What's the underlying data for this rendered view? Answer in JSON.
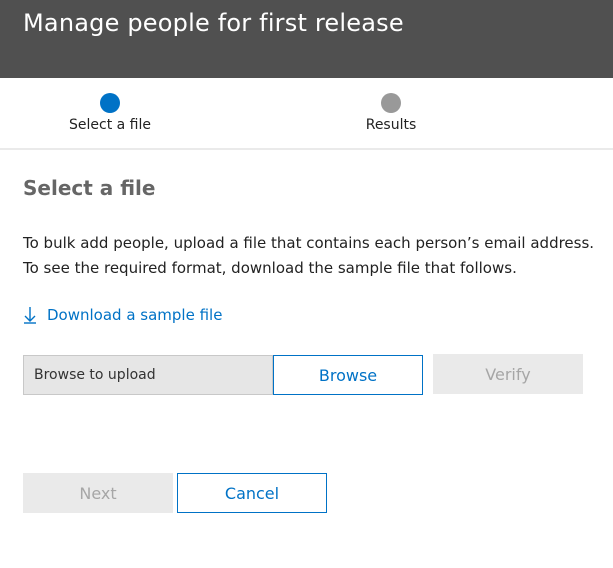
{
  "header": {
    "title": "Manage people for first release"
  },
  "stepper": {
    "steps": [
      {
        "label": "Select a file",
        "state": "active",
        "color": "#0072c6"
      },
      {
        "label": "Results",
        "state": "inactive",
        "color": "#999999"
      }
    ]
  },
  "content": {
    "title": "Select a file",
    "description": "To bulk add people, upload a file that contains each person’s email address. To see the required format, download the sample file that follows.",
    "download_link": {
      "label": "Download a sample file",
      "icon": "download-icon"
    }
  },
  "upload": {
    "field_text": "Browse to upload",
    "browse_label": "Browse",
    "verify_label": "Verify"
  },
  "footer": {
    "next_label": "Next",
    "cancel_label": "Cancel"
  },
  "colors": {
    "header_bg": "#505050",
    "accent": "#0072c6",
    "disabled_bg": "#eaeaea",
    "disabled_text": "#a6a6a6"
  }
}
